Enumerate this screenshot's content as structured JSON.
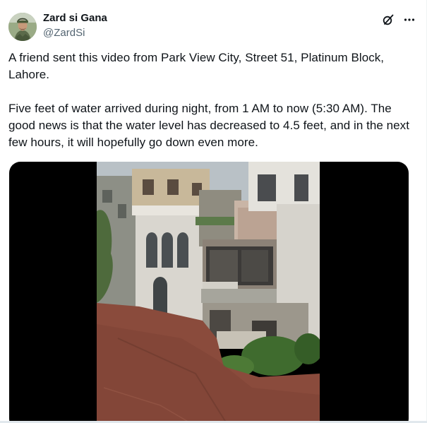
{
  "author": {
    "display_name": "Zard si Gana",
    "handle": "@ZardSi",
    "avatar_icon": "profile-avatar"
  },
  "actions": {
    "grok_icon": "grok-icon",
    "more_icon": "more-options-icon"
  },
  "tweet": {
    "paragraph_1": "A friend sent this video from Park View City, Street 51, Platinum Block, Lahore.",
    "paragraph_2": "Five feet of water arrived during night, from 1 AM to now (5:30 AM). The good news is that the water level has decreased to 4.5 feet, and in the next few hours, it will hopefully go down even more."
  },
  "media": {
    "type": "video",
    "background": "#000000"
  },
  "colors": {
    "text": "#0f1419",
    "secondary": "#536471",
    "floodwater": "#8a4b3c"
  }
}
